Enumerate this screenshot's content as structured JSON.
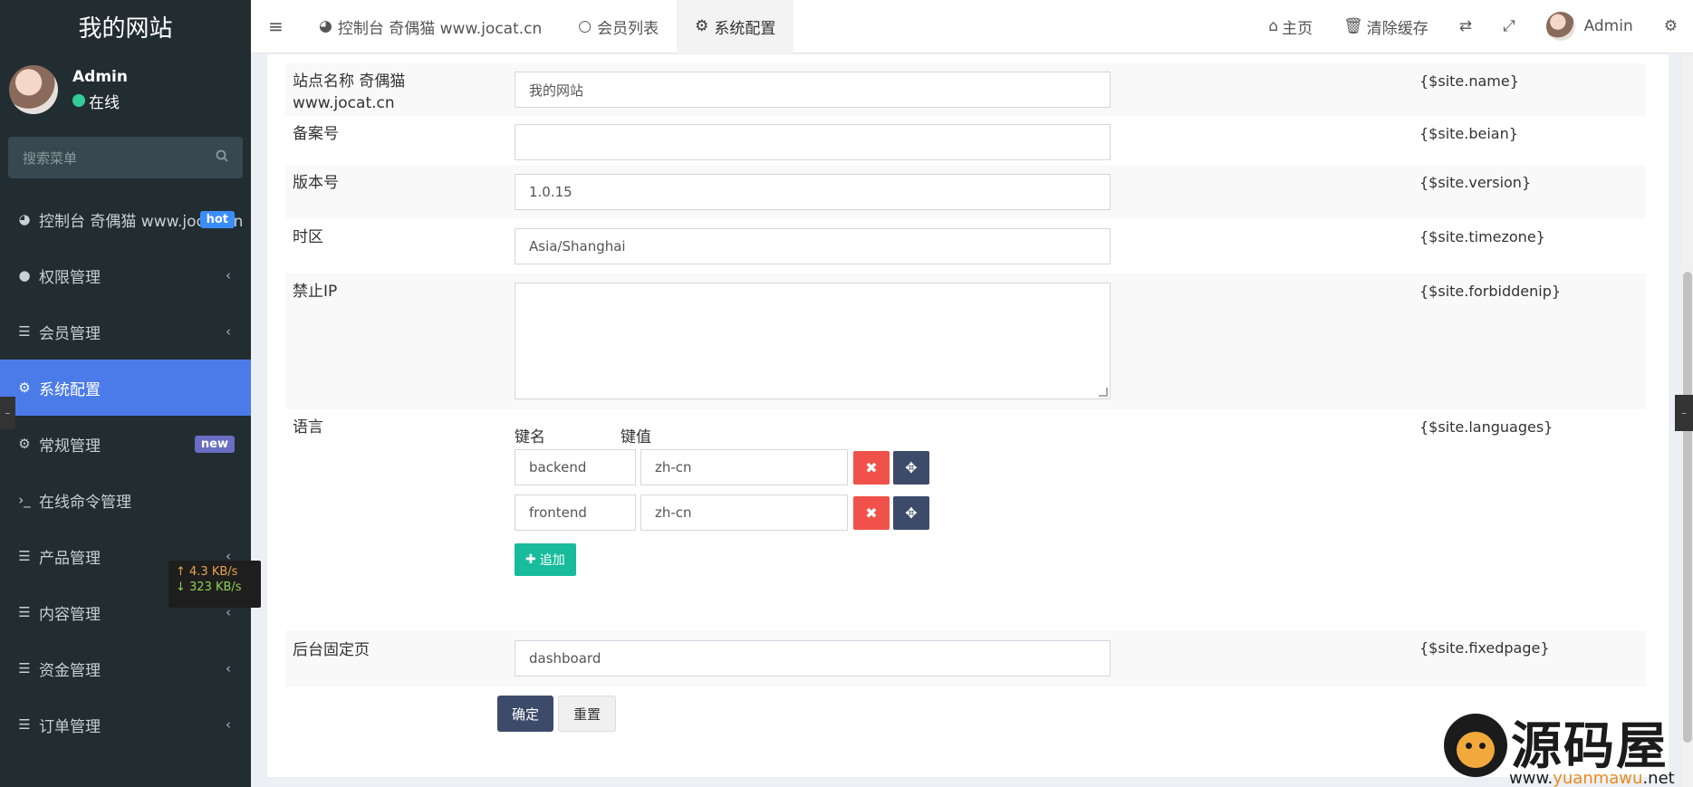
{
  "brand": "我的网站",
  "user": {
    "name": "Admin",
    "status": "在线"
  },
  "search": {
    "placeholder": "搜索菜单"
  },
  "menu": [
    {
      "label": "控制台 奇偶猫 www.jocat.cn",
      "icon": "dashboard-icon",
      "badge": "hot",
      "chevron": false
    },
    {
      "label": "权限管理",
      "icon": "users-icon",
      "chevron": true
    },
    {
      "label": "会员管理",
      "icon": "list-icon",
      "chevron": true
    },
    {
      "label": "系统配置",
      "icon": "gear-icon",
      "active": true
    },
    {
      "label": "常规管理",
      "icon": "gears-icon",
      "badge": "new"
    },
    {
      "label": "在线命令管理",
      "icon": "terminal-icon"
    },
    {
      "label": "产品管理",
      "icon": "list-icon",
      "chevron": true
    },
    {
      "label": "内容管理",
      "icon": "list-icon",
      "chevron": true
    },
    {
      "label": "资金管理",
      "icon": "list-icon",
      "chevron": true
    },
    {
      "label": "订单管理",
      "icon": "list-icon",
      "chevron": true
    }
  ],
  "net": {
    "up": "↑ 4.3 KB/s",
    "down": "↓ 323 KB/s"
  },
  "tabs": [
    {
      "label": "控制台 奇偶猫 www.jocat.cn",
      "icon": "dashboard-icon"
    },
    {
      "label": "会员列表",
      "icon": "circle-icon"
    },
    {
      "label": "系统配置",
      "icon": "gear-icon",
      "active": true
    }
  ],
  "topright": {
    "home": "主页",
    "clear_cache": "清除缓存",
    "user": "Admin"
  },
  "form": {
    "site_name": {
      "label_line1": "站点名称 奇偶猫",
      "label_line2": "www.jocat.cn",
      "value": "我的网站",
      "var": "{$site.name}"
    },
    "beian": {
      "label": "备案号",
      "value": "",
      "var": "{$site.beian}"
    },
    "version": {
      "label": "版本号",
      "value": "1.0.15",
      "var": "{$site.version}"
    },
    "timezone": {
      "label": "时区",
      "value": "Asia/Shanghai",
      "var": "{$site.timezone}"
    },
    "forbiddenip": {
      "label": "禁止IP",
      "value": "",
      "var": "{$site.forbiddenip}"
    },
    "languages": {
      "label": "语言",
      "key_header": "键名",
      "value_header": "键值",
      "var": "{$site.languages}",
      "rows": [
        {
          "key": "backend",
          "value": "zh-cn"
        },
        {
          "key": "frontend",
          "value": "zh-cn"
        }
      ],
      "add_label": "追加"
    },
    "fixedpage": {
      "label": "后台固定页",
      "value": "dashboard",
      "var": "{$site.fixedpage}"
    },
    "ok_label": "确定",
    "reset_label": "重置"
  },
  "watermark": {
    "text": "源码屋",
    "url_pre": "www.",
    "url_hl": "yuanmawu",
    "url_post": ".net"
  }
}
